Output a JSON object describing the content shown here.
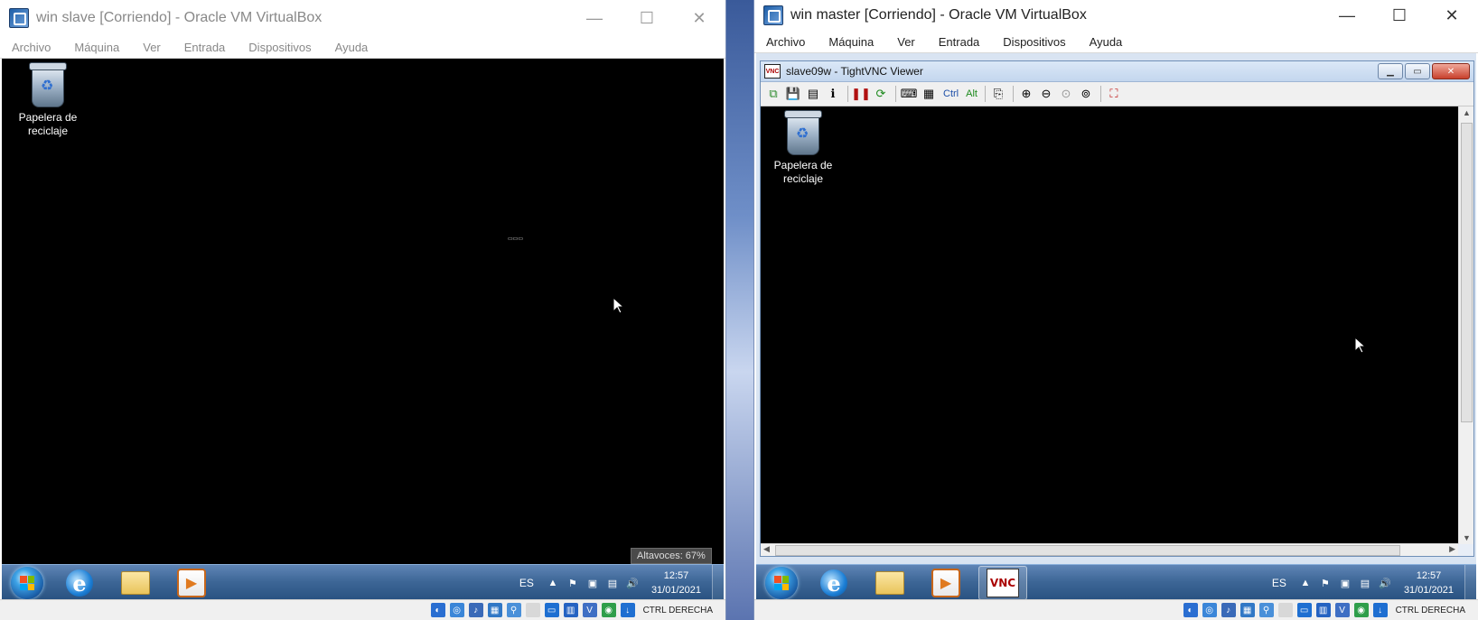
{
  "slave_window": {
    "title": "win slave [Corriendo] - Oracle VM VirtualBox",
    "controls": {
      "minimize": "—",
      "maximize": "☐",
      "close": "✕"
    },
    "menu": [
      "Archivo",
      "Máquina",
      "Ver",
      "Entrada",
      "Dispositivos",
      "Ayuda"
    ],
    "desktop_icon_label": "Papelera de reciclaje",
    "tooltip": "Altavoces: 67%",
    "tray": {
      "lang": "ES",
      "time": "12:57",
      "date": "31/01/2021"
    },
    "host_key_label": "CTRL DERECHA"
  },
  "master_window": {
    "title": "win master [Corriendo] - Oracle VM VirtualBox",
    "controls": {
      "minimize": "—",
      "maximize": "☐",
      "close": "✕"
    },
    "menu": [
      "Archivo",
      "Máquina",
      "Ver",
      "Entrada",
      "Dispositivos",
      "Ayuda"
    ],
    "vnc": {
      "title": "slave09w - TightVNC Viewer",
      "toolbar_text_buttons": [
        "Ctrl",
        "Alt"
      ],
      "desktop_icon_label": "Papelera de reciclaje"
    },
    "tray": {
      "lang": "ES",
      "time": "12:57",
      "date": "31/01/2021"
    },
    "host_key_label": "CTRL DERECHA"
  },
  "icons": {
    "vbox_app": "virtualbox-icon",
    "recycle_bin": "recycle-bin-icon",
    "start": "windows-start-icon",
    "ie": "internet-explorer-icon",
    "explorer": "folder-icon",
    "media": "media-player-icon",
    "vnc": "tightvnc-icon"
  },
  "colors": {
    "vm_screen": "#000000",
    "taskbar": "#3e6797",
    "statusbar": "#f0f0f0"
  }
}
